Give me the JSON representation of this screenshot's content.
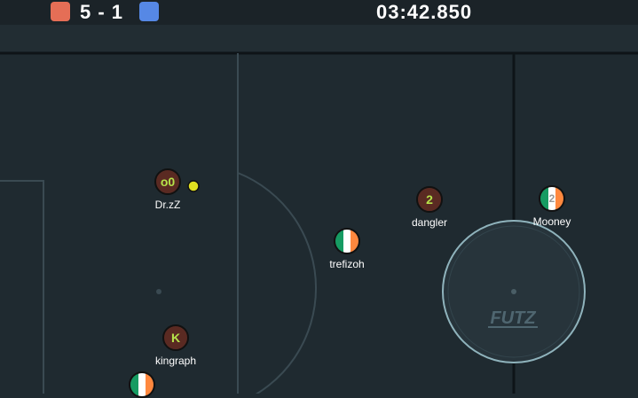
{
  "score": {
    "red": 5,
    "blue": 1,
    "text": "5 - 1"
  },
  "timer": "03:42.850",
  "colors": {
    "red_team": "#e56e56",
    "blue_team": "#5688e5",
    "pitch": "#1f2a30",
    "disc_dark": "#5a2a22",
    "avatar_text": "#b6e34a",
    "ball": "#e0e020",
    "irish_flag": [
      "#169b62",
      "#ffffff",
      "#ff883e"
    ]
  },
  "players": [
    {
      "name": "Dr.zZ",
      "avatar": "o0",
      "style": "dark"
    },
    {
      "name": "dangler",
      "avatar": "2",
      "style": "dark"
    },
    {
      "name": "Mooney",
      "avatar": "2",
      "style": "flag"
    },
    {
      "name": "trefizoh",
      "avatar": "",
      "style": "flag"
    },
    {
      "name": "kingraph",
      "avatar": "K",
      "style": "dark"
    },
    {
      "name": "",
      "avatar": "",
      "style": "flag"
    }
  ],
  "logo": "FUTZ"
}
